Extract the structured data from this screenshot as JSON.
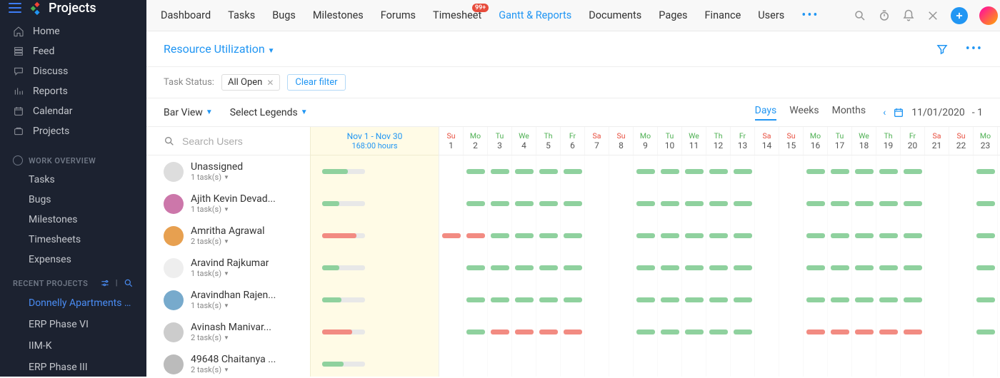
{
  "brand": {
    "name": "Projects"
  },
  "sidebar": {
    "nav": [
      {
        "label": "Home",
        "icon": "home"
      },
      {
        "label": "Feed",
        "icon": "feed"
      },
      {
        "label": "Discuss",
        "icon": "discuss"
      },
      {
        "label": "Reports",
        "icon": "reports"
      },
      {
        "label": "Calendar",
        "icon": "calendar"
      },
      {
        "label": "Projects",
        "icon": "projects"
      }
    ],
    "work_header": "WORK OVERVIEW",
    "work": [
      {
        "label": "Tasks"
      },
      {
        "label": "Bugs"
      },
      {
        "label": "Milestones"
      },
      {
        "label": "Timesheets"
      },
      {
        "label": "Expenses"
      }
    ],
    "recent_header": "RECENT PROJECTS",
    "recent": [
      {
        "label": "Donnelly Apartments Co",
        "active": true
      },
      {
        "label": "ERP Phase VI"
      },
      {
        "label": "IIM-K"
      },
      {
        "label": "ERP Phase III"
      }
    ]
  },
  "topbar": {
    "tabs": [
      {
        "label": "Dashboard"
      },
      {
        "label": "Tasks"
      },
      {
        "label": "Bugs"
      },
      {
        "label": "Milestones"
      },
      {
        "label": "Forums"
      },
      {
        "label": "Timesheet",
        "badge": "99+"
      },
      {
        "label": "Gantt & Reports",
        "active": true
      },
      {
        "label": "Documents"
      },
      {
        "label": "Pages"
      },
      {
        "label": "Finance"
      },
      {
        "label": "Users"
      }
    ]
  },
  "subbar": {
    "title": "Resource Utilization"
  },
  "filterbar": {
    "label": "Task Status:",
    "chip": "All Open",
    "clear": "Clear filter"
  },
  "viewbar": {
    "barview": "Bar View",
    "legends": "Select Legends",
    "gran": [
      "Days",
      "Weeks",
      "Months"
    ],
    "gran_active": 0,
    "date": "11/01/2020",
    "date_suffix": "- 1"
  },
  "search": {
    "placeholder": "Search Users"
  },
  "summary": {
    "range": "Nov 1 - Nov 30",
    "hours": "168:00 hours"
  },
  "calendar": {
    "start_day": 1,
    "dows": [
      "Su",
      "Mo",
      "Tu",
      "We",
      "Th",
      "Fr",
      "Sa"
    ],
    "ncols": 27
  },
  "users": [
    {
      "name": "Unassigned",
      "tasks": "1 task(s)",
      "summary": {
        "fill": 60,
        "color": "#8fd19e"
      },
      "avatar": "#ddd",
      "cells": [
        "",
        "g",
        "g",
        "g",
        "g",
        "g",
        "",
        "",
        "g",
        "g",
        "g",
        "g",
        "g",
        "",
        "",
        "g",
        "g",
        "g",
        "g",
        "g",
        "",
        "",
        "g",
        "g",
        "g",
        "g",
        "g"
      ]
    },
    {
      "name": "Ajith Kevin Devad...",
      "tasks": "1 task(s)",
      "summary": {
        "fill": 40,
        "color": "#8fd19e"
      },
      "avatar": "#c7a",
      "cells": [
        "",
        "g",
        "g",
        "g",
        "g",
        "g",
        "",
        "",
        "g",
        "g",
        "g",
        "g",
        "g",
        "",
        "",
        "g",
        "g",
        "g",
        "g",
        "g",
        "",
        "",
        "g",
        "g",
        "g",
        "g",
        "g"
      ]
    },
    {
      "name": "Amritha Agrawal",
      "tasks": "2 task(s)",
      "summary": {
        "fill": 80,
        "color": "#f28b82"
      },
      "avatar": "#e7a050",
      "cells": [
        "r",
        "r",
        "g",
        "g",
        "g",
        "g",
        "",
        "",
        "g",
        "g",
        "g",
        "g",
        "g",
        "",
        "",
        "g",
        "g",
        "g",
        "g",
        "g",
        "",
        "",
        "g",
        "g",
        "g",
        "g",
        "g"
      ]
    },
    {
      "name": "Aravind Rajkumar",
      "tasks": "1 task(s)",
      "summary": {
        "fill": 40,
        "color": "#8fd19e"
      },
      "avatar": "#eee",
      "cells": [
        "",
        "g",
        "g",
        "g",
        "g",
        "g",
        "",
        "",
        "g",
        "g",
        "g",
        "g",
        "g",
        "",
        "",
        "g",
        "g",
        "g",
        "g",
        "g",
        "",
        "",
        "g",
        "g",
        "g",
        "g",
        "g"
      ]
    },
    {
      "name": "Aravindhan Rajen...",
      "tasks": "1 task(s)",
      "summary": {
        "fill": 45,
        "color": "#8fd19e"
      },
      "avatar": "#7ac",
      "cells": [
        "",
        "g",
        "g",
        "g",
        "g",
        "g",
        "",
        "",
        "g",
        "g",
        "g",
        "g",
        "g",
        "",
        "",
        "g",
        "g",
        "g",
        "g",
        "g",
        "",
        "",
        "g",
        "g",
        "g",
        "g",
        "g"
      ]
    },
    {
      "name": "Avinash Manivar...",
      "tasks": "2 task(s)",
      "summary": {
        "fill": 70,
        "color": "#f28b82"
      },
      "avatar": "#ccc",
      "cells": [
        "",
        "g",
        "r",
        "r",
        "r",
        "r",
        "",
        "",
        "g",
        "g",
        "g",
        "g",
        "g",
        "",
        "",
        "r",
        "r",
        "r",
        "r",
        "r",
        "",
        "",
        "g",
        "g",
        "g",
        "g",
        "g"
      ]
    },
    {
      "name": "49648 Chaitanya ...",
      "tasks": "2 task(s)",
      "summary": {
        "fill": 50,
        "color": "#8fd19e"
      },
      "avatar": "#bbb",
      "cells": [
        "",
        "",
        "",
        "",
        "",
        "",
        "",
        "",
        "",
        "",
        "",
        "",
        "",
        "",
        "",
        "",
        "",
        "",
        "",
        "",
        "",
        "",
        "",
        "",
        "",
        "",
        ""
      ]
    }
  ]
}
